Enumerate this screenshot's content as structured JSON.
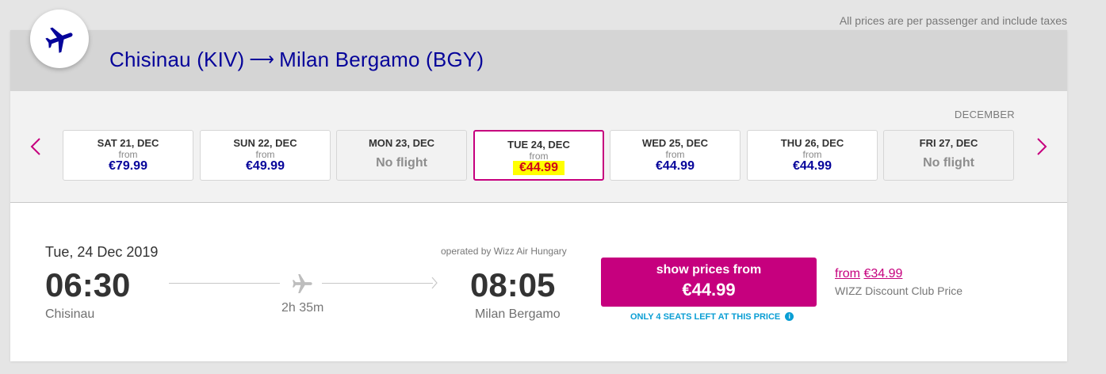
{
  "tax_note": "All prices are per passenger and include taxes",
  "route": {
    "origin": "Chisinau (KIV)",
    "arrow": "⟶",
    "destination": "Milan Bergamo (BGY)"
  },
  "month": "DECEMBER",
  "days": [
    {
      "name": "SAT 21, DEC",
      "from": "from",
      "price": "€79.99"
    },
    {
      "name": "SUN 22, DEC",
      "from": "from",
      "price": "€49.99"
    },
    {
      "name": "MON 23, DEC",
      "none": "No flight"
    },
    {
      "name": "TUE 24, DEC",
      "from": "from",
      "price": "€44.99"
    },
    {
      "name": "WED 25, DEC",
      "from": "from",
      "price": "€44.99"
    },
    {
      "name": "THU 26, DEC",
      "from": "from",
      "price": "€44.99"
    },
    {
      "name": "FRI 27, DEC",
      "none": "No flight"
    }
  ],
  "flight": {
    "date": "Tue, 24 Dec 2019",
    "dep_time": "06:30",
    "dep_city": "Chisinau",
    "duration": "2h 35m",
    "operated_by": "operated by Wizz Air Hungary",
    "arr_time": "08:05",
    "arr_city": "Milan Bergamo",
    "button_line1": "show prices from",
    "button_price": "€44.99",
    "seats_note": "ONLY 4 SEATS LEFT AT THIS PRICE",
    "club_from": "from",
    "club_price": "€34.99",
    "club_label": "WIZZ Discount Club Price"
  },
  "colors": {
    "brand_blue": "#06049a",
    "brand_magenta": "#c6007e",
    "highlight": "#ffff00",
    "info_blue": "#0a9ed4"
  }
}
